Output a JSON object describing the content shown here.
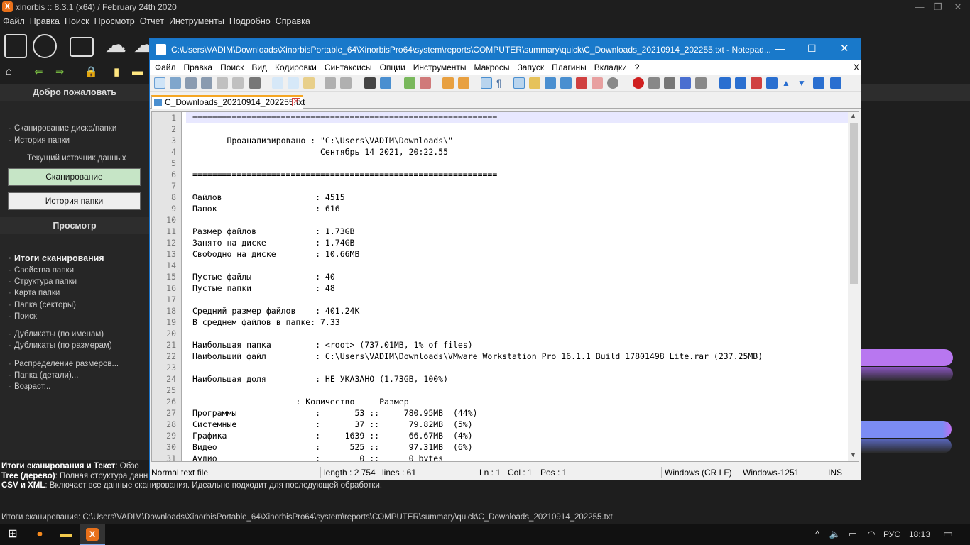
{
  "xinorbis": {
    "title": "xinorbis :: 8.3.1 (x64) / February 24th 2020",
    "menu": [
      "Файл",
      "Правка",
      "Поиск",
      "Просмотр",
      "Отчет",
      "Инструменты",
      "Подробно",
      "Справка"
    ],
    "left_panel": {
      "welcome_header": "Добро пожаловать",
      "scan_disk": "Сканирование диска/папки",
      "folder_history": "История папки",
      "current_source": "Текущий источник данных",
      "scan_button": "Сканирование",
      "history_button": "История папки",
      "view_header": "Просмотр",
      "items": [
        "Итоги сканирования",
        "Свойства папки",
        "Структура папки",
        "Карта папки",
        "Папка (секторы)",
        "Поиск",
        "Дубликаты (по именам)",
        "Дубликаты (по размерам)",
        "Распределение размеров...",
        "Папка (детали)...",
        "Возраст..."
      ]
    },
    "info_lines": [
      {
        "bold": "Итоги сканирования и Текст",
        "text": ": Обзо"
      },
      {
        "bold": "Tree (дерево)",
        "text": ": Полная структура данн"
      },
      {
        "bold": "CSV и XML",
        "text": ": Включает все данные сканирования. Идеально подходит для последующей обработки."
      }
    ],
    "status": "Итоги сканирования: C:\\Users\\VADIM\\Downloads\\XinorbisPortable_64\\XinorbisPro64\\system\\reports\\COMPUTER\\summary\\quick\\C_Downloads_20210914_202255.txt"
  },
  "notepad": {
    "title": "C:\\Users\\VADIM\\Downloads\\XinorbisPortable_64\\XinorbisPro64\\system\\reports\\COMPUTER\\summary\\quick\\C_Downloads_20210914_202255.txt - Notepad...",
    "menu": [
      "Файл",
      "Правка",
      "Поиск",
      "Вид",
      "Кодировки",
      "Синтаксисы",
      "Опции",
      "Инструменты",
      "Макросы",
      "Запуск",
      "Плагины",
      "Вкладки",
      "?"
    ],
    "menu_close": "X",
    "tab_name": "C_Downloads_20210914_202255.txt",
    "lines": [
      "==============================================================",
      "",
      "       Проанализировано : \"C:\\Users\\VADIM\\Downloads\\\"",
      "                          Сентябрь 14 2021, 20:22.55",
      "",
      "==============================================================",
      "",
      "Файлов                   : 4515",
      "Папок                    : 616",
      "",
      "Размер файлов            : 1.73GB",
      "Занято на диске          : 1.74GB",
      "Свободно на диске        : 10.66MB",
      "",
      "Пустые файлы             : 40",
      "Пустые папки             : 48",
      "",
      "Средний размер файлов    : 401.24K",
      "В среднем файлов в папке: 7.33",
      "",
      "Наибольшая папка         : <root> (737.01MB, 1% of files)",
      "Наибольший файл          : C:\\Users\\VADIM\\Downloads\\VMware Workstation Pro 16.1.1 Build 17801498 Lite.rar (237.25MB)",
      "",
      "Наибольшая доля          : НЕ УКАЗАНО (1.73GB, 100%)",
      "",
      "                     : Количество     Размер",
      "Программы                :       53 ::     780.95MB  (44%)",
      "Системные                :       37 ::      79.82MB  (5%)",
      "Графика                  :     1639 ::      66.67MB  (4%)",
      "Видео                    :      525 ::      97.31MB  (6%)",
      "Аудио                    :        0 ::      0 bytes"
    ],
    "status": {
      "type": "Normal text file",
      "length": "length : 2 754",
      "lines": "lines : 61",
      "ln": "Ln : 1",
      "col": "Col : 1",
      "pos": "Pos : 1",
      "eol": "Windows (CR LF)",
      "encoding": "Windows-1251",
      "mode": "INS"
    }
  },
  "taskbar": {
    "lang": "РУС",
    "time": "18:13"
  },
  "colors": {
    "scan_button": "#c6e5c6",
    "np_title": "#1979ca",
    "bar_purple": "#b877f0",
    "bar_blue": "#7b8cf4"
  }
}
